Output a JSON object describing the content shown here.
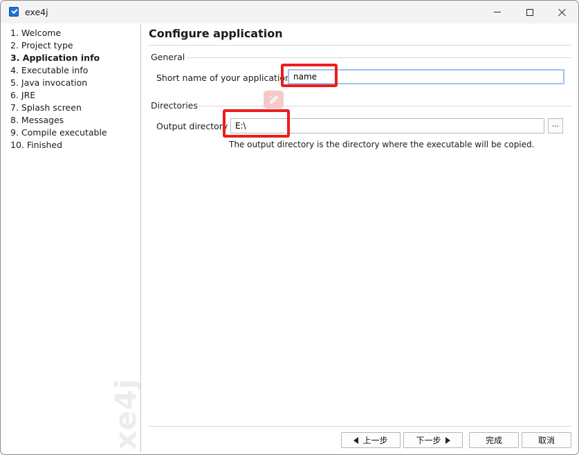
{
  "window": {
    "title": "exe4j"
  },
  "sidebar": {
    "steps": [
      {
        "label": "1. Welcome"
      },
      {
        "label": "2. Project type"
      },
      {
        "label": "3. Application info"
      },
      {
        "label": "4. Executable info"
      },
      {
        "label": "5. Java invocation"
      },
      {
        "label": "6. JRE"
      },
      {
        "label": "7. Splash screen"
      },
      {
        "label": "8. Messages"
      },
      {
        "label": "9. Compile executable"
      },
      {
        "label": "10. Finished"
      }
    ],
    "active_step": 3,
    "watermark": "exe4j"
  },
  "main": {
    "title": "Configure application",
    "general": {
      "label": "General",
      "short_name_label": "Short name of your application",
      "short_name_value": "name"
    },
    "directories": {
      "label": "Directories",
      "output_dir_label": "Output directory",
      "output_dir_value": "E:\\",
      "browse_label": "...",
      "hint": "The output directory is the directory where the executable will be copied."
    }
  },
  "buttons": {
    "back": "上一步",
    "next": "下一步",
    "finish": "完成",
    "cancel": "取消"
  },
  "colors": {
    "annotation": "#ee1c1c",
    "focus_border": "#9ec2ee",
    "app_icon": "#1e6fd9"
  },
  "icons": {
    "app": "exe4j-app-icon",
    "minimize": "minimize-icon",
    "maximize": "maximize-icon",
    "close": "close-icon",
    "pen": "pen-icon"
  }
}
